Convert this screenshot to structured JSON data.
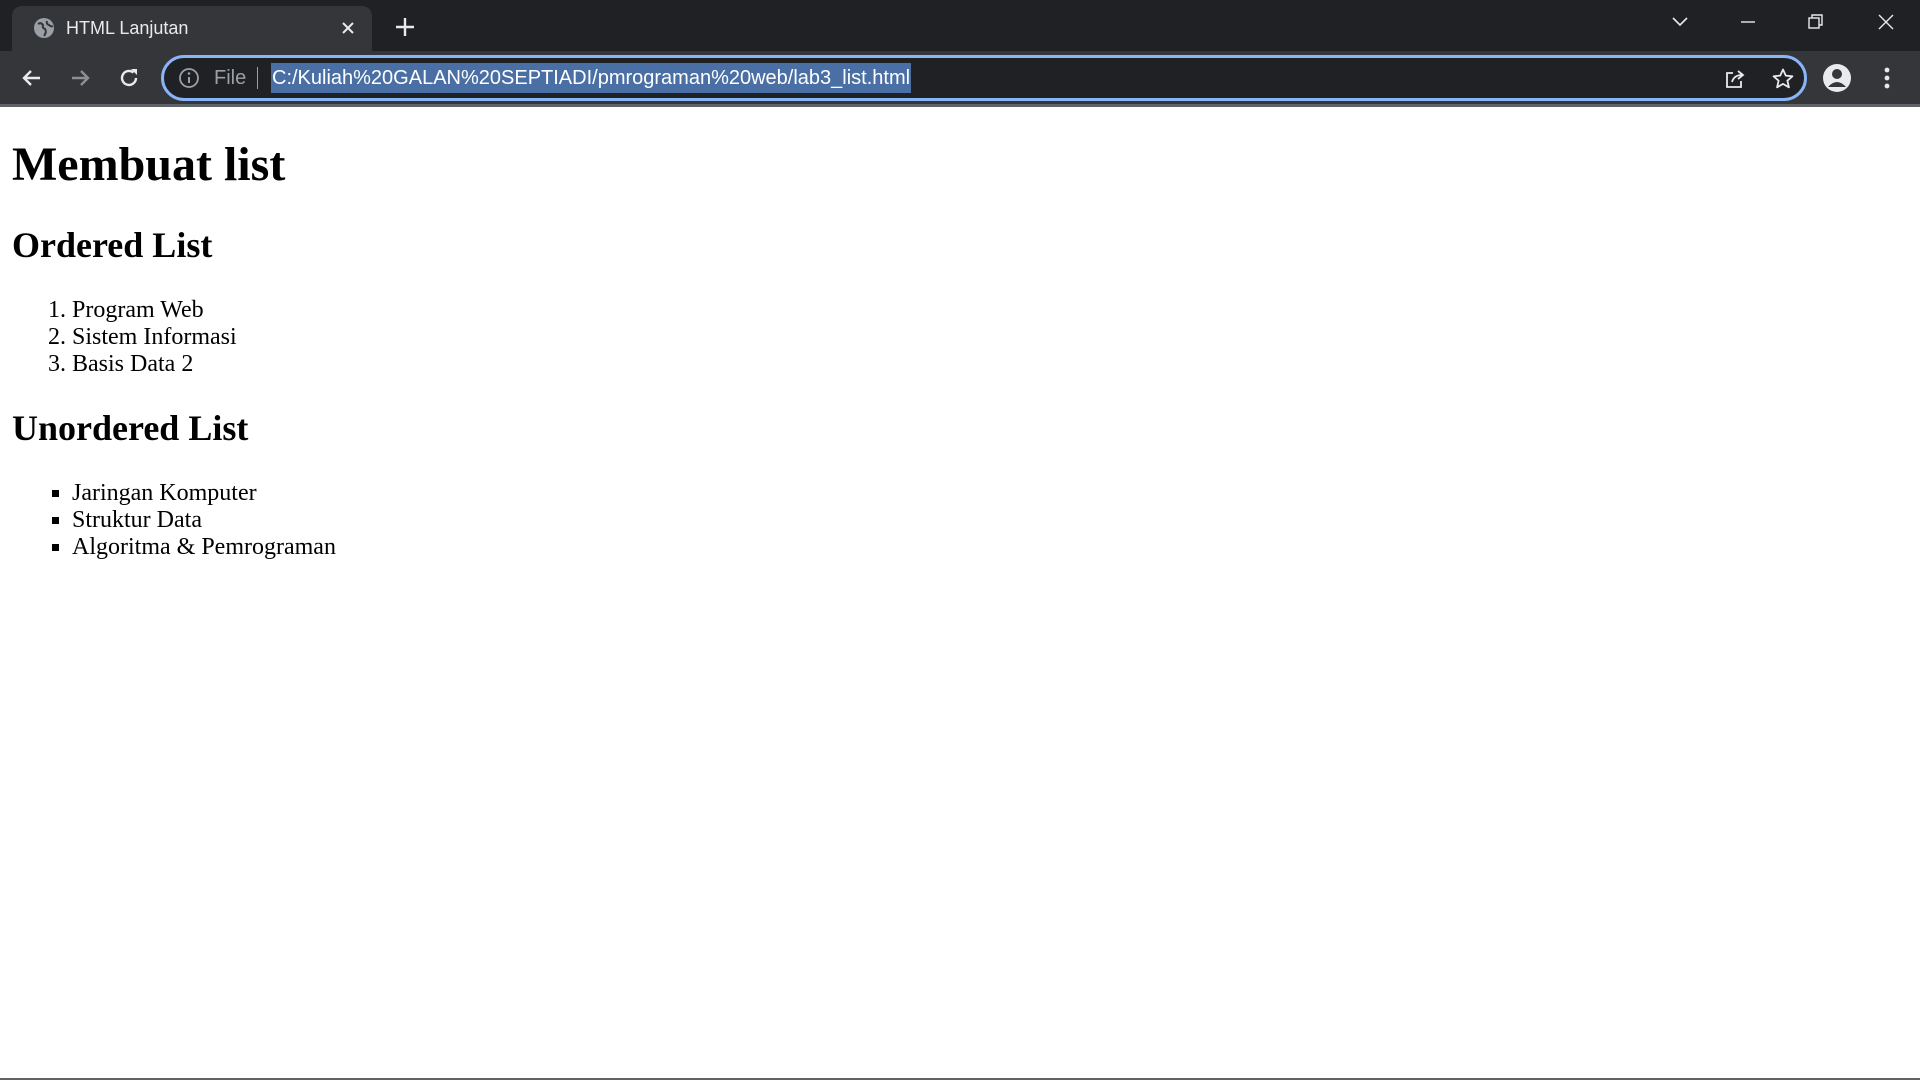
{
  "browser": {
    "tab": {
      "title": "HTML Lanjutan",
      "favicon": "globe-icon"
    },
    "omnibox": {
      "scheme_label": "File",
      "url": "C:/Kuliah%20GALAN%20SEPTIADI/pmrograman%20web/lab3_list.html"
    }
  },
  "page": {
    "heading": "Membuat list",
    "ordered_heading": "Ordered List",
    "ordered_items": [
      "Program Web",
      "Sistem Informasi",
      "Basis Data 2"
    ],
    "unordered_heading": "Unordered List",
    "unordered_items": [
      "Jaringan Komputer",
      "Struktur Data",
      "Algoritma & Pemrograman"
    ]
  },
  "colors": {
    "tabstrip": "#202124",
    "toolbar": "#35363a",
    "focus_ring": "#8ab4f8",
    "url_selection": "#4a6fa5"
  }
}
